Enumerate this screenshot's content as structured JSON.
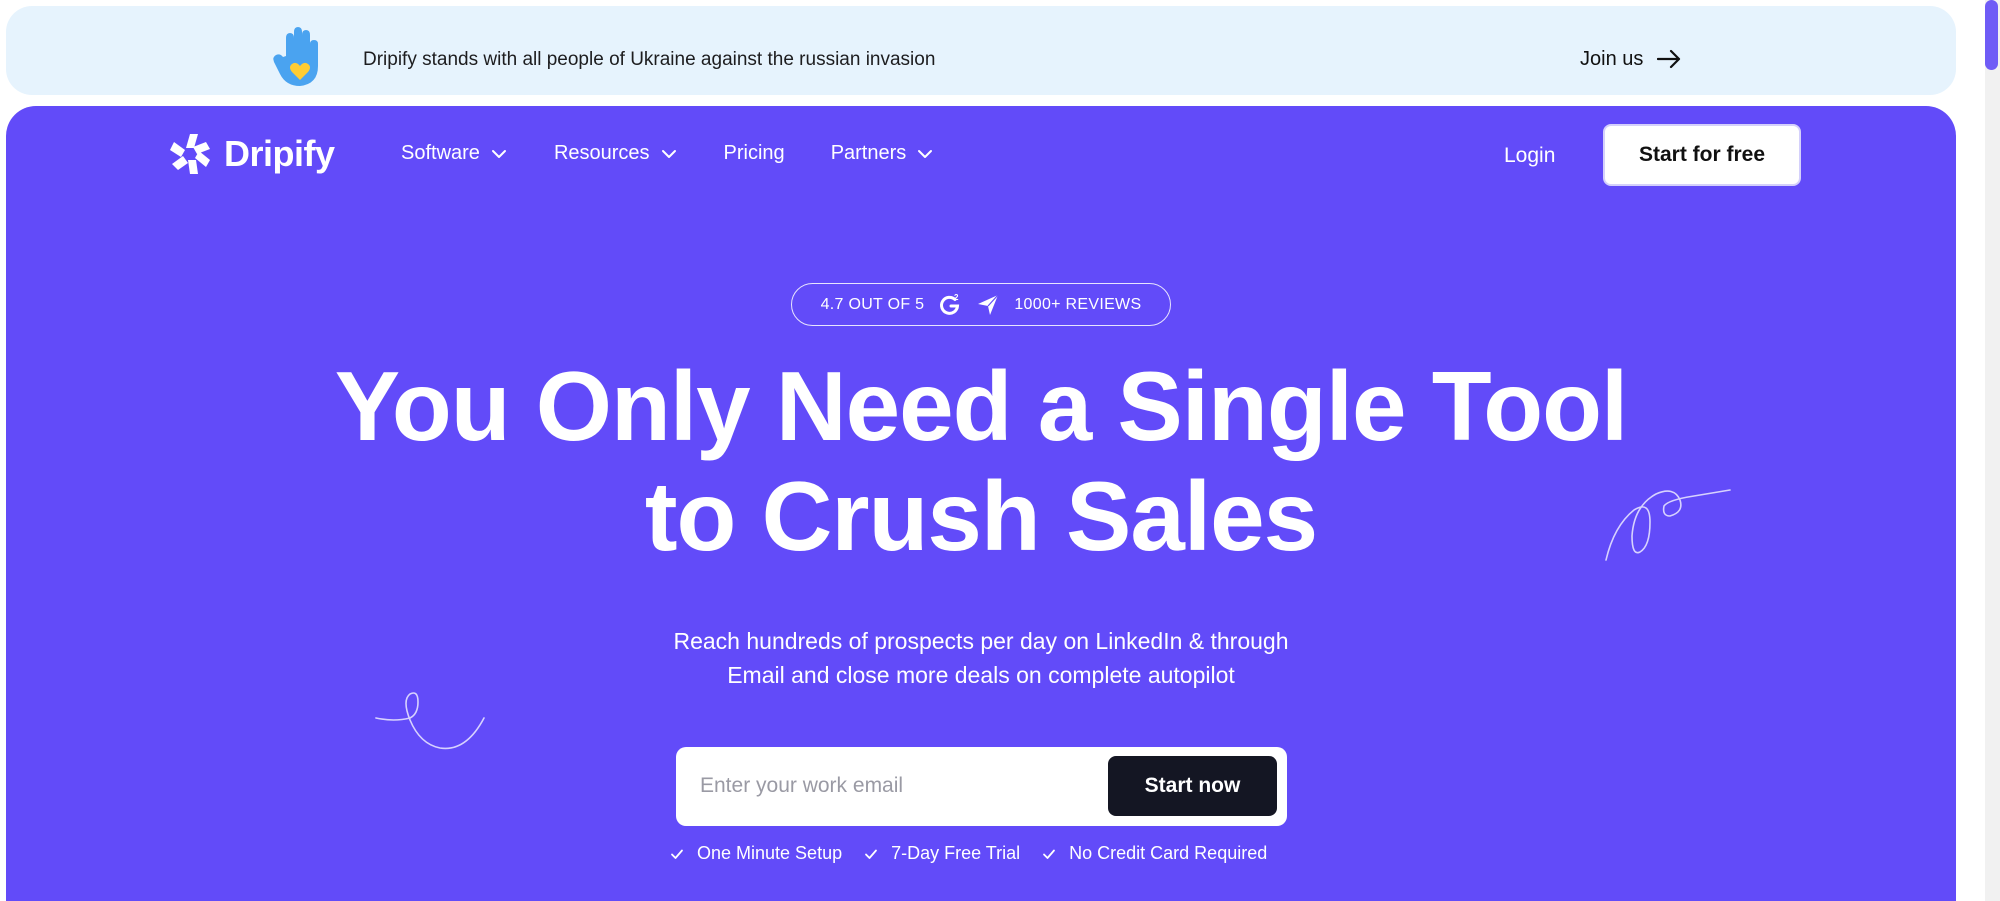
{
  "banner": {
    "message": "Dripify stands with all people of Ukraine against the russian invasion",
    "join_label": "Join us",
    "icon": "raised-hand-heart-icon",
    "colors": {
      "background": "#e6f3fd",
      "hand": "#4aa3f0",
      "heart": "#ffcc33"
    }
  },
  "header": {
    "logo_text": "Dripify",
    "nav": [
      {
        "label": "Software",
        "has_dropdown": true
      },
      {
        "label": "Resources",
        "has_dropdown": true
      },
      {
        "label": "Pricing",
        "has_dropdown": false
      },
      {
        "label": "Partners",
        "has_dropdown": true
      }
    ],
    "login_label": "Login",
    "cta_label": "Start for free"
  },
  "hero": {
    "rating_score": "4.7 OUT OF 5",
    "reviews": "1000+ REVIEWS",
    "title_line1": "You Only Need a Single Tool",
    "title_line2": "to Crush Sales",
    "subtitle_line1": "Reach hundreds of prospects per day on LinkedIn & through",
    "subtitle_line2": "Email and close more deals on complete autopilot",
    "email_placeholder": "Enter your work email",
    "email_value": "",
    "submit_label": "Start now",
    "perks": [
      "One Minute Setup",
      "7-Day Free Trial",
      "No Credit Card Required"
    ],
    "colors": {
      "background": "#624bf9",
      "button": "#141623"
    }
  }
}
